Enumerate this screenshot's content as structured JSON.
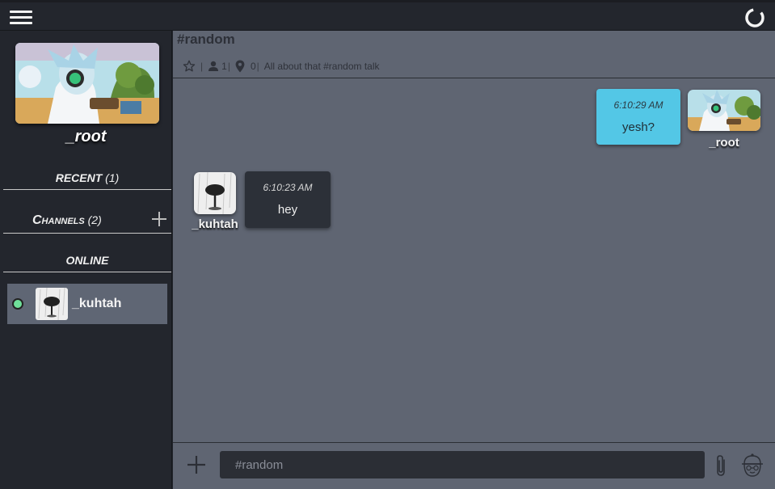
{
  "topbar": {
    "menu_icon": "hamburger-menu-icon",
    "status_icon": "loading-ring-icon"
  },
  "sidebar": {
    "profile": {
      "name": "_root",
      "image_icon": "profile-picture"
    },
    "recent": {
      "label": "RECENT",
      "count": "(1)"
    },
    "channels": {
      "label": "Channels",
      "count": "(2)",
      "add_icon": "plus-icon"
    },
    "online": {
      "label": "ONLINE",
      "users": [
        {
          "name": "_kuhtah",
          "status": "online"
        }
      ]
    }
  },
  "channel": {
    "title": "#random",
    "members": "1",
    "pins": "0",
    "topic": "All about that #random talk"
  },
  "messages": [
    {
      "author": "_root",
      "time": "6:10:29 AM",
      "text": "yesh?",
      "own": true
    },
    {
      "author": "_kuhtah",
      "time": "6:10:23 AM",
      "text": "hey",
      "own": false
    }
  ],
  "composer": {
    "placeholder": "#random",
    "add_icon": "plus-icon",
    "attach_icon": "paperclip-icon",
    "emoji_icon": "emoji-face-icon"
  },
  "colors": {
    "own_bubble": "#53c7e6",
    "other_bubble": "#2c3038",
    "online_dot": "#6fe09a",
    "main_bg": "#5f6572",
    "sidebar_bg": "#23262d"
  }
}
